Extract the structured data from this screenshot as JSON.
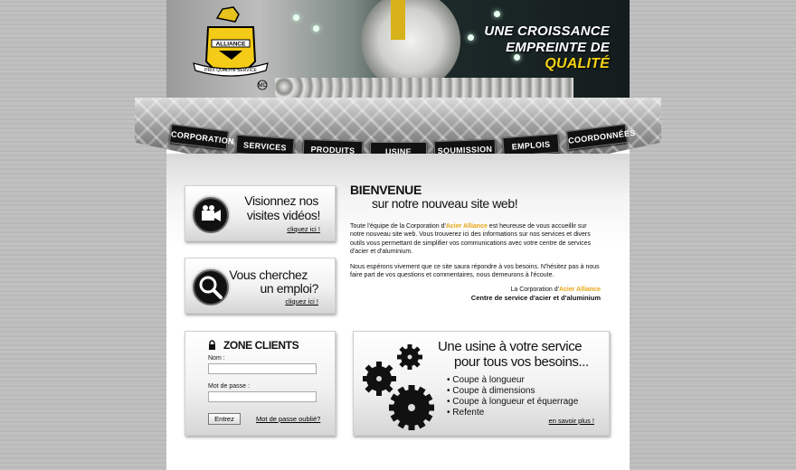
{
  "banner": {
    "logo_text_top": "ALLIANCE",
    "logo_text_band": "PRIX QUALITÉ SERVICE",
    "logo_mark": "MC",
    "tagline": [
      "UNE CROISSANCE",
      "EMPREINTE DE"
    ],
    "tagline_accent": "QUALITÉ"
  },
  "nav": [
    "CORPORATION",
    "SERVICES",
    "PRODUITS",
    "USINE",
    "SOUMISSION",
    "EMPLOIS",
    "COORDONNÉES"
  ],
  "videos": {
    "line1": "Visionnez nos",
    "line2": "visites vidéos!",
    "link": "cliquez ici !"
  },
  "emploi": {
    "line1": "Vous cherchez",
    "line2": "un emploi?",
    "link": "cliquez ici !"
  },
  "welcome": {
    "title": "BIENVENUE",
    "subtitle": "sur notre nouveau site web!",
    "p1_a": "Toute l'équipe de la Corporation d'",
    "p1_brand": "Acier Alliance",
    "p1_b": " est heureuse de vous accueillir sur notre nouveau site web. Vous trouverez ici des informations sur nos services et divers outils vous permettant de simplifier vos communications avec votre centre de services d'acier et d'aluminium.",
    "p2": "Nous espérons vivement que ce site saura répondre à vos besoins. N'hésitez pas à nous faire part de vos questions et commentaires, nous demeurons à l'écoute.",
    "sig_a": "La Corporation d'",
    "sig_brand": "Acier Alliance",
    "sig_line2": "Centre de service d'acier et d'aluminium"
  },
  "clients": {
    "title": "ZONE CLIENTS",
    "name_label": "Nom :",
    "name_value": "",
    "pass_label": "Mot de passe :",
    "pass_value": "",
    "submit": "Entrez",
    "forgot": "Mot de passe oublié?"
  },
  "usine": {
    "line1": "Une usine à votre service",
    "line2": "pour tous vos besoins...",
    "items": [
      "• Coupe à longueur",
      "• Coupe à dimensions",
      "• Coupe à longueur et équerrage",
      "• Refente"
    ],
    "link": "en savoir plus !"
  },
  "colors": {
    "accent": "#f5d215",
    "brand": "#e8a514",
    "nav_bg": "#111111"
  }
}
